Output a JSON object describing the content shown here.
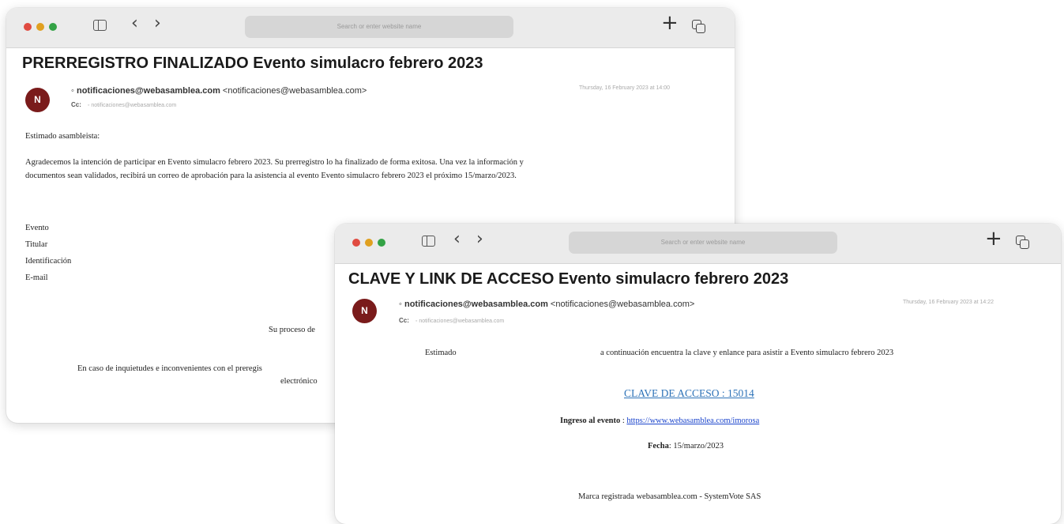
{
  "window1": {
    "address_placeholder": "Search or enter website name",
    "subject": "PRERREGISTRO FINALIZADO  Evento simulacro febrero 2023",
    "avatar_initial": "N",
    "from_bullet": "◦ ",
    "from_email": "notificaciones@webasamblea.com",
    "from_full": " <notificaciones@webasamblea.com>",
    "cc_label": "Cc:",
    "cc_value": "◦ notificaciones@webasamblea.com",
    "date": "Thursday, 16 February 2023 at 14:00",
    "greeting": "Estimado asambleista:",
    "paragraph_line1": "Agradecemos la intención de participar en Evento simulacro febrero 2023. Su prerregistro lo ha finalizado de forma exitosa. Una vez la información y",
    "paragraph_line2": "documentos sean validados, recibirá un correo de aprobación para la asistencia al evento Evento simulacro febrero 2023 el próximo 15/marzo/2023.",
    "fields": [
      "Evento",
      "Titular",
      "Identificación",
      "E-mail"
    ],
    "process_text": "Su proceso de",
    "footer_line1": "En caso de inquietudes e inconvenientes con el preregis",
    "footer_line2": "electrónico"
  },
  "window2": {
    "address_placeholder": "Search or enter website name",
    "subject": "CLAVE Y LINK DE ACCESO Evento simulacro febrero 2023",
    "avatar_initial": "N",
    "from_bullet": "◦ ",
    "from_email": "notificaciones@webasamblea.com",
    "from_full": " <notificaciones@webasamblea.com>",
    "cc_label": "Cc:",
    "cc_value": "◦ notificaciones@webasamblea.com",
    "date": "Thursday, 16 February 2023 at 14:22",
    "estimado": "Estimado",
    "intro": "a continuación encuentra la clave y enlance para asistir a Evento simulacro febrero 2023",
    "clave_label": "CLAVE DE ACCESO :  15014",
    "ingreso_label": "Ingreso al evento",
    "ingreso_sep": " : ",
    "ingreso_url": "https://www.webasamblea.com/imorosa",
    "fecha_label": "Fecha",
    "fecha_value": ": 15/marzo/2023",
    "footer": "Marca registrada webasamblea.com - SystemVote SAS"
  },
  "toolbar": {
    "back_glyph": "‹",
    "forward_glyph": "›",
    "plus_glyph": "+"
  },
  "colors": {
    "avatar": "#7a1b1b",
    "clave": "#2e73b8",
    "link": "#1a44cc"
  }
}
